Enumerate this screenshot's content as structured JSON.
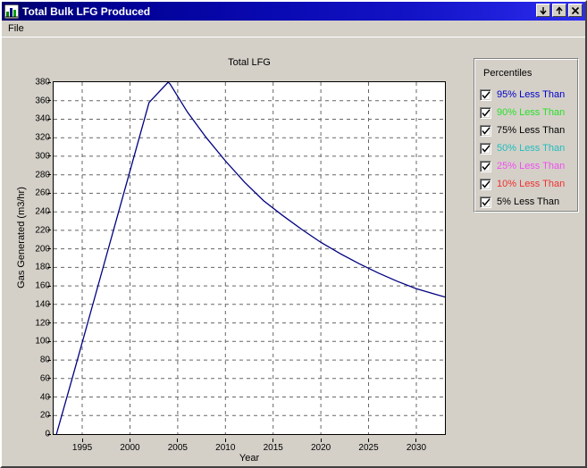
{
  "window": {
    "title": "Total Bulk LFG Produced",
    "icon": "app-chart-icon",
    "buttons": {
      "minimize": "↓",
      "maximize": "↑",
      "close": "✕"
    }
  },
  "menu": {
    "items": [
      {
        "label": "File"
      }
    ]
  },
  "legend": {
    "title": "Percentiles",
    "items": [
      {
        "label": "95% Less Than",
        "color": "#0000c8",
        "checked": true
      },
      {
        "label": "90% Less Than",
        "color": "#2ae02a",
        "checked": true
      },
      {
        "label": "75% Less Than",
        "color": "#000000",
        "checked": true
      },
      {
        "label": "50% Less Than",
        "color": "#1fbdbd",
        "checked": true
      },
      {
        "label": "25% Less Than",
        "color": "#ef4fef",
        "checked": true
      },
      {
        "label": "10% Less Than",
        "color": "#f03030",
        "checked": true
      },
      {
        "label": "5% Less Than",
        "color": "#000000",
        "checked": true
      }
    ]
  },
  "chart_data": {
    "type": "line",
    "title": "Total LFG",
    "xlabel": "Year",
    "ylabel": "Gas Generated (m3/hr)",
    "xlim": [
      1992,
      2033
    ],
    "ylim": [
      0,
      380
    ],
    "xticks": [
      1995,
      2000,
      2005,
      2010,
      2015,
      2020,
      2025,
      2030
    ],
    "yticks": [
      0,
      20,
      40,
      60,
      80,
      100,
      120,
      140,
      160,
      180,
      200,
      220,
      240,
      260,
      280,
      300,
      320,
      340,
      360,
      380
    ],
    "grid": true,
    "legend_position": "right-external",
    "series": [
      {
        "name": "Total LFG",
        "color": "#000080",
        "x": [
          1992.3,
          1994,
          1996,
          1998,
          2000,
          2002,
          2004,
          2004.2,
          2006,
          2008,
          2010,
          2012,
          2014,
          2016,
          2018,
          2020,
          2022,
          2024,
          2026,
          2028,
          2030,
          2032,
          2033
        ],
        "y": [
          0,
          62,
          136,
          210,
          284,
          358,
          380,
          378,
          348,
          320,
          295,
          272,
          252,
          236,
          221,
          207,
          195,
          184,
          174,
          165,
          157,
          151,
          148
        ]
      }
    ]
  }
}
